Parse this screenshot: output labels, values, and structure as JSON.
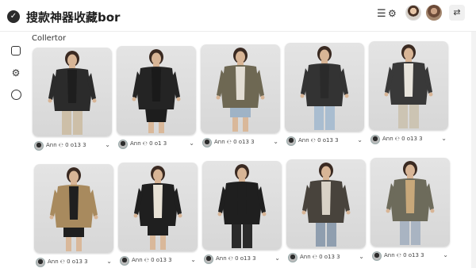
{
  "header": {
    "title": "搜款神器收藏bor",
    "logo_glyph": "✓",
    "caret": "⌄",
    "list_icon": "☰",
    "gear_icon": "⚙",
    "swap_icon": "⇄"
  },
  "rail": {
    "icons": [
      "bag-icon",
      "gear-icon",
      "circle-icon"
    ],
    "gear_glyph": "⚙"
  },
  "section": {
    "title": "Collertor"
  },
  "products": [
    {
      "meta": "Ann ℮ 0 o13 3",
      "coat": "#2b2b2b",
      "inner": "#1e1e1e",
      "bottom": "#cdbfa8",
      "bottom_type": "pants"
    },
    {
      "meta": "Ann ℮ 0 o1 3",
      "coat": "#242424",
      "inner": "#1a1a1a",
      "bottom": "#1d1d1d",
      "bottom_type": "skirt"
    },
    {
      "meta": "Ann ℮ 0 o13 3",
      "coat": "#6e6853",
      "inner": "#e2ddd3",
      "bottom": "#9fb3c6",
      "bottom_type": "shorts"
    },
    {
      "meta": "Ann ℮ 0 o13 3",
      "coat": "#333333",
      "inner": "#2a2a2a",
      "bottom": "#a9bdd0",
      "bottom_type": "pants"
    },
    {
      "meta": "Ann ℮ 0 o13 3",
      "coat": "#393939",
      "inner": "#e8e4dc",
      "bottom": "#ccc4b3",
      "bottom_type": "pants"
    },
    {
      "meta": "Ann ℮ 0 o13 3",
      "coat": "#a88a5e",
      "inner": "#1f1f1f",
      "bottom": "#1f1f1f",
      "bottom_type": "shorts"
    },
    {
      "meta": "Ann ℮ 0 o13 3",
      "coat": "#1f1f1f",
      "inner": "#e8e2d6",
      "bottom": "#1f1f1f",
      "bottom_type": "shorts"
    },
    {
      "meta": "Ann ℮ 0 o13 3",
      "coat": "#1f1f1f",
      "inner": "#1f1f1f",
      "bottom": "#2a2a2a",
      "bottom_type": "pants"
    },
    {
      "meta": "Ann ℮ 0 o13 3",
      "coat": "#48433c",
      "inner": "#d9d2c6",
      "bottom": "#8f9eaf",
      "bottom_type": "pants"
    },
    {
      "meta": "Ann ℮ 0 o13 3",
      "coat": "#6d6b5b",
      "inner": "#c8a87a",
      "bottom": "#a9b4c2",
      "bottom_type": "pants"
    }
  ],
  "meta_caret": "⌄"
}
